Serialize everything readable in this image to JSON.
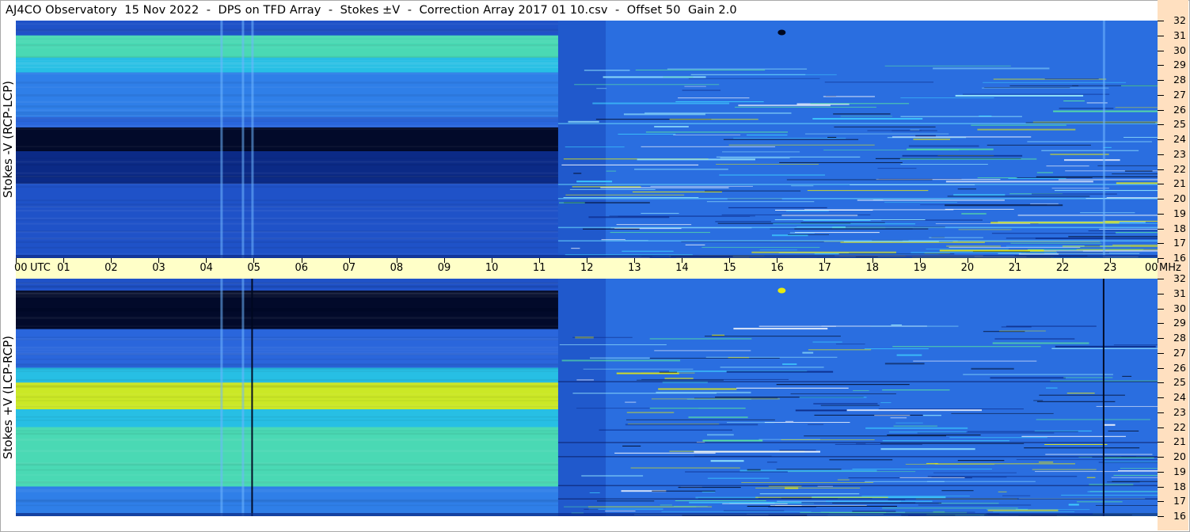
{
  "window": {
    "title": "AJ4CO Observatory  15 Nov 2022  -  DPS on TFD Array  -  Stokes ±V  -  Correction Array 2017 01 10.csv  -  Offset 50  Gain 2.0"
  },
  "chart_data": {
    "type": "heatmap",
    "title": "AJ4CO Observatory  15 Nov 2022  -  DPS on TFD Array  -  Stokes ±V  -  Correction Array 2017 01 10.csv  -  Offset 50  Gain 2.0",
    "x_unit_label": "UTC",
    "y_unit_label": "MHz",
    "x_ticks": [
      "00",
      "01",
      "02",
      "03",
      "04",
      "05",
      "06",
      "07",
      "08",
      "09",
      "10",
      "11",
      "12",
      "13",
      "14",
      "15",
      "16",
      "17",
      "18",
      "19",
      "20",
      "21",
      "22",
      "23",
      "00"
    ],
    "xlim": [
      0,
      24
    ],
    "ylim": [
      16,
      32
    ],
    "y_ticks": [
      16,
      17,
      18,
      19,
      20,
      21,
      22,
      23,
      24,
      25,
      26,
      27,
      28,
      29,
      30,
      31,
      32
    ],
    "colormap": [
      "#000820",
      "#061c6a",
      "#123ea8",
      "#2a66dc",
      "#3c8ef0",
      "#2fb6f0",
      "#22d8d8",
      "#5ae6a0",
      "#b4e83a",
      "#e6ea10"
    ],
    "panels": [
      {
        "ylabel": "Stokes -V (RCP-LCP)",
        "bands_before_11_4_utc": [
          {
            "mhz": [
              31.0,
              32.0
            ],
            "level": "medium-blue"
          },
          {
            "mhz": [
              29.5,
              31.0
            ],
            "level": "cyan-green"
          },
          {
            "mhz": [
              28.5,
              29.5
            ],
            "level": "cyan"
          },
          {
            "mhz": [
              25.5,
              28.5
            ],
            "level": "light-blue"
          },
          {
            "mhz": [
              24.8,
              25.5
            ],
            "level": "blue"
          },
          {
            "mhz": [
              23.2,
              24.8
            ],
            "level": "black"
          },
          {
            "mhz": [
              21.0,
              23.2
            ],
            "level": "dark-blue"
          },
          {
            "mhz": [
              16.0,
              21.0
            ],
            "level": "medium-blue"
          }
        ],
        "vertical_lines_utc": [
          4.3,
          4.75,
          4.95,
          22.85
        ]
      },
      {
        "ylabel": "Stokes +V (LCP-RCP)",
        "bands_before_11_4_utc": [
          {
            "mhz": [
              31.2,
              32.0
            ],
            "level": "medium-blue"
          },
          {
            "mhz": [
              28.6,
              31.2
            ],
            "level": "black"
          },
          {
            "mhz": [
              26.0,
              28.6
            ],
            "level": "blue"
          },
          {
            "mhz": [
              25.0,
              26.0
            ],
            "level": "cyan"
          },
          {
            "mhz": [
              23.2,
              25.0
            ],
            "level": "yellow"
          },
          {
            "mhz": [
              22.0,
              23.2
            ],
            "level": "cyan"
          },
          {
            "mhz": [
              18.0,
              22.0
            ],
            "level": "cyan-green"
          },
          {
            "mhz": [
              16.0,
              18.0
            ],
            "level": "light-blue"
          }
        ],
        "vertical_lines_utc": [
          4.3,
          4.75,
          4.95,
          22.85
        ]
      }
    ],
    "grid": false
  }
}
